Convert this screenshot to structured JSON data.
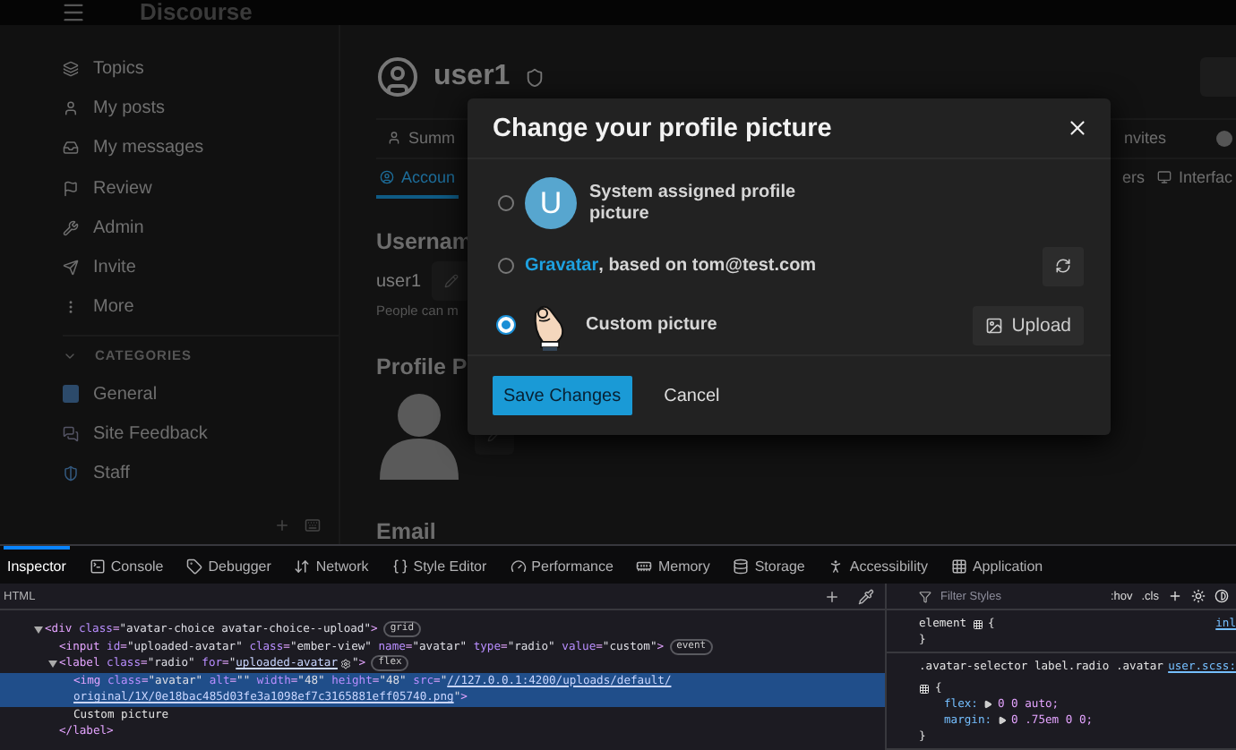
{
  "header": {
    "logo": "Discourse"
  },
  "sidebar": {
    "items": [
      {
        "label": "Topics"
      },
      {
        "label": "My posts"
      },
      {
        "label": "My messages"
      },
      {
        "label": "Review"
      },
      {
        "label": "Admin"
      },
      {
        "label": "Invite"
      },
      {
        "label": "More"
      }
    ],
    "section": {
      "title": "CATEGORIES",
      "expanded": true
    },
    "categories": [
      {
        "label": "General"
      },
      {
        "label": "Site Feedback"
      },
      {
        "label": "Staff"
      }
    ]
  },
  "profile": {
    "username": "user1",
    "tabs_top": [
      {
        "label": "Summ",
        "selected": false
      },
      {
        "label": "nvites",
        "selected": false
      }
    ],
    "tabs_bottom": [
      {
        "label": "Accoun",
        "selected": true
      },
      {
        "label": "ers",
        "selected": false
      },
      {
        "label": "Interfac",
        "selected": false
      }
    ],
    "username_heading": "Usernam",
    "username_value": "user1",
    "username_help": "People can m",
    "picture_heading": "Profile P",
    "email_heading": "Email"
  },
  "modal": {
    "title": "Change your profile picture",
    "options": [
      {
        "kind": "system",
        "selected": false,
        "letter": "U",
        "label": "System assigned profile picture"
      },
      {
        "kind": "gravatar",
        "selected": false,
        "link": "Gravatar",
        "label": ", based on tom@test.com"
      },
      {
        "kind": "custom",
        "selected": true,
        "label": "Custom picture",
        "button": "Upload"
      }
    ],
    "save": "Save Changes",
    "cancel": "Cancel"
  },
  "devtools": {
    "tabs": [
      {
        "label": "Inspector",
        "selected": true
      },
      {
        "label": "Console",
        "selected": false
      },
      {
        "label": "Debugger",
        "selected": false
      },
      {
        "label": "Network",
        "selected": false
      },
      {
        "label": "Style Editor",
        "selected": false
      },
      {
        "label": "Performance",
        "selected": false
      },
      {
        "label": "Memory",
        "selected": false
      },
      {
        "label": "Storage",
        "selected": false
      },
      {
        "label": "Accessibility",
        "selected": false
      },
      {
        "label": "Application",
        "selected": false
      }
    ],
    "breadcrumb": "HTML",
    "nodes": [
      {
        "expanded": true,
        "selected": false,
        "badge": "grid",
        "lines": [
          [
            {
              "kind": "tag",
              "t": "<div "
            },
            {
              "kind": "attr",
              "t": "class"
            },
            {
              "kind": "tag",
              "t": "="
            },
            {
              "kind": "val",
              "t": "\"avatar-choice avatar-choice--upload\""
            },
            {
              "kind": "tag",
              "t": ">"
            }
          ]
        ],
        "children": [
          {
            "selected": false,
            "badge": "event",
            "lines": [
              [
                {
                  "kind": "tag",
                  "t": "<input "
                },
                {
                  "kind": "attr",
                  "t": "id"
                },
                {
                  "kind": "tag",
                  "t": "="
                },
                {
                  "kind": "val",
                  "t": "\"uploaded-avatar\" "
                },
                {
                  "kind": "attr",
                  "t": "class"
                },
                {
                  "kind": "tag",
                  "t": "="
                },
                {
                  "kind": "val",
                  "t": "\"ember-view\" "
                },
                {
                  "kind": "attr",
                  "t": "name"
                },
                {
                  "kind": "tag",
                  "t": "="
                },
                {
                  "kind": "val",
                  "t": "\"avatar\" "
                },
                {
                  "kind": "attr",
                  "t": "type"
                },
                {
                  "kind": "tag",
                  "t": "="
                },
                {
                  "kind": "val",
                  "t": "\"radio\" "
                },
                {
                  "kind": "attr",
                  "t": "value"
                },
                {
                  "kind": "tag",
                  "t": "="
                },
                {
                  "kind": "val",
                  "t": "\"custom\""
                },
                {
                  "kind": "tag",
                  "t": ">"
                }
              ]
            ]
          },
          {
            "expanded": true,
            "selected": false,
            "badge": "flex",
            "closing": "</label>",
            "lines": [
              [
                {
                  "kind": "tag",
                  "t": "<label "
                },
                {
                  "kind": "attr",
                  "t": "class"
                },
                {
                  "kind": "tag",
                  "t": "="
                },
                {
                  "kind": "val",
                  "t": "\"radio\" "
                },
                {
                  "kind": "attr",
                  "t": "for"
                },
                {
                  "kind": "tag",
                  "t": "="
                },
                {
                  "kind": "val",
                  "t": "\""
                },
                {
                  "kind": "link",
                  "t": "uploaded-avatar"
                },
                {
                  "kind": "gear"
                },
                {
                  "kind": "val",
                  "t": "\""
                },
                {
                  "kind": "tag",
                  "t": ">"
                }
              ]
            ],
            "children": [
              {
                "selected": true,
                "lines": [
                  [
                    {
                      "kind": "tag",
                      "t": "<img "
                    },
                    {
                      "kind": "attr",
                      "t": "class"
                    },
                    {
                      "kind": "tag",
                      "t": "="
                    },
                    {
                      "kind": "val",
                      "t": "\"avatar\" "
                    },
                    {
                      "kind": "attr",
                      "t": "alt"
                    },
                    {
                      "kind": "tag",
                      "t": "="
                    },
                    {
                      "kind": "val",
                      "t": "\"\" "
                    },
                    {
                      "kind": "attr",
                      "t": "width"
                    },
                    {
                      "kind": "tag",
                      "t": "="
                    },
                    {
                      "kind": "val",
                      "t": "\"48\" "
                    },
                    {
                      "kind": "attr",
                      "t": "height"
                    },
                    {
                      "kind": "tag",
                      "t": "="
                    },
                    {
                      "kind": "val",
                      "t": "\"48\" "
                    },
                    {
                      "kind": "attr",
                      "t": "src"
                    },
                    {
                      "kind": "tag",
                      "t": "="
                    },
                    {
                      "kind": "val",
                      "t": "\""
                    },
                    {
                      "kind": "link",
                      "t": "//127.0.0.1:4200/uploads/default/"
                    }
                  ],
                  [
                    {
                      "kind": "link",
                      "t": "original/1X/0e18bac485d03fe3a1098ef7c3165881eff05740.png"
                    },
                    {
                      "kind": "val",
                      "t": "\""
                    },
                    {
                      "kind": "tag",
                      "t": ">"
                    }
                  ]
                ]
              },
              {
                "selected": false,
                "lines": [
                  [
                    {
                      "kind": "text",
                      "t": "Custom picture"
                    }
                  ]
                ]
              }
            ]
          }
        ]
      }
    ],
    "styles": {
      "filter_placeholder": "Filter Styles",
      "hov": ":hov",
      "cls": ".cls",
      "rules": [
        {
          "selector": "element",
          "source": "inl",
          "open": "{",
          "close": "}"
        },
        {
          "selector": ".avatar-selector label.radio .avatar",
          "source": "user.scss:",
          "open": "{",
          "close": "}",
          "decls": [
            {
              "prop": "flex:",
              "value": "0 0 auto;"
            },
            {
              "prop": "margin:",
              "value": "0 .75em 0 0;"
            }
          ]
        }
      ]
    }
  }
}
